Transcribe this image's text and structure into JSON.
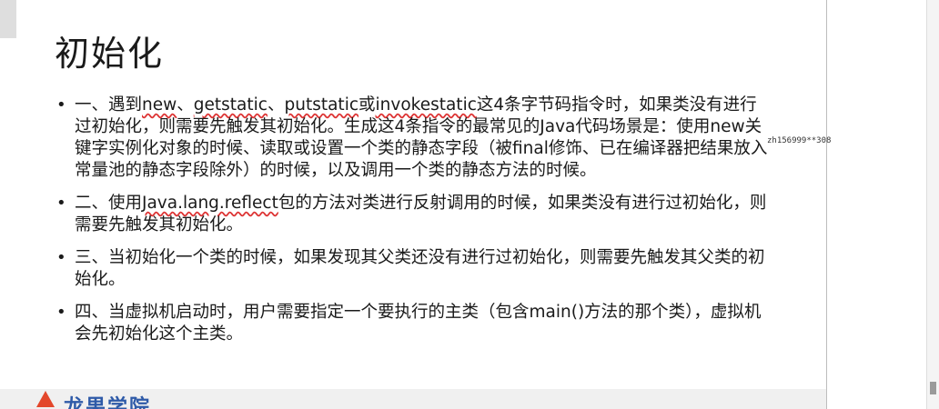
{
  "slide": {
    "title": "初始化",
    "bullets": [
      {
        "parts": [
          {
            "t": "一、遇到"
          },
          {
            "t": "new",
            "u": true
          },
          {
            "t": "、"
          },
          {
            "t": "getstatic",
            "u": true
          },
          {
            "t": "、"
          },
          {
            "t": "putstatic",
            "u": true
          },
          {
            "t": "或"
          },
          {
            "t": "invokestatic",
            "u": true
          },
          {
            "t": "这4条字节码指令时，如果类没有进行过初始化，则需要先触发其初始化。生成这4条指令的最常见的Java代码场景是：使用new关键字实例化对象的时候、读取或设置一个类的静态字段（被final修饰、已在编译器把结果放入常量池的静态字段除外）的时候，以及调用一个类的静态方法的时候。"
          }
        ]
      },
      {
        "parts": [
          {
            "t": "二、使用"
          },
          {
            "t": "Java.lang.reflect",
            "u": true
          },
          {
            "t": "包的方法对类进行反射调用的时候，如果类没有进行过初始化，则需要先触发其初始化。"
          }
        ]
      },
      {
        "parts": [
          {
            "t": "三、当初始化一个类的时候，如果发现其父类还没有进行过初始化，则需要先触发其父类的初始化。"
          }
        ]
      },
      {
        "parts": [
          {
            "t": "四、当虚拟机启动时，用户需要指定一个要执行的主类（包含main()方法的那个类），虚拟机会先初始化这个主类。"
          }
        ]
      }
    ]
  },
  "watermark": "zh156999**308",
  "footer": {
    "logo_text": "龙果学院",
    "logo_color": "#2e5aa8",
    "logo_icon": "flame-icon",
    "icon_color": "#e3472b"
  },
  "colors": {
    "underline": "#dd3333"
  }
}
